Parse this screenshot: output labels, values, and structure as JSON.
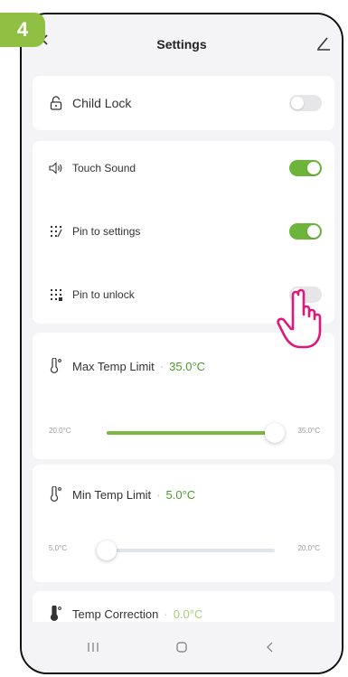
{
  "step_badge": "4",
  "header": {
    "title": "Settings"
  },
  "settings": {
    "child_lock": {
      "label": "Child Lock",
      "on": false
    },
    "touch_sound": {
      "label": "Touch Sound",
      "on": true
    },
    "pin_to_settings": {
      "label": "Pin to settings",
      "on": true
    },
    "pin_to_unlock": {
      "label": "Pin to unlock",
      "on": false
    }
  },
  "max_temp": {
    "label": "Max Temp Limit",
    "separator": "·",
    "value": "35.0°C",
    "min_label": "20.0°C",
    "max_label": "35.0°C",
    "level": 1.0
  },
  "min_temp": {
    "label": "Min Temp Limit",
    "separator": "·",
    "value": "5.0°C",
    "min_label": "5.0°C",
    "max_label": "20.0°C",
    "level": 0.0
  },
  "temp_correction": {
    "label": "Temp Correction",
    "separator": "·",
    "value": "0.0°C"
  },
  "icons": {
    "back": "chevron-left-icon",
    "edit": "edit-pencil-icon",
    "lock": "lock-icon",
    "speaker": "speaker-icon",
    "grid": "keypad-icon",
    "thermometer": "thermometer-icon",
    "hand": "pointing-hand-icon"
  },
  "colors": {
    "accent": "#6cb43a",
    "badge": "#8fc043",
    "hand": "#e0187a"
  }
}
